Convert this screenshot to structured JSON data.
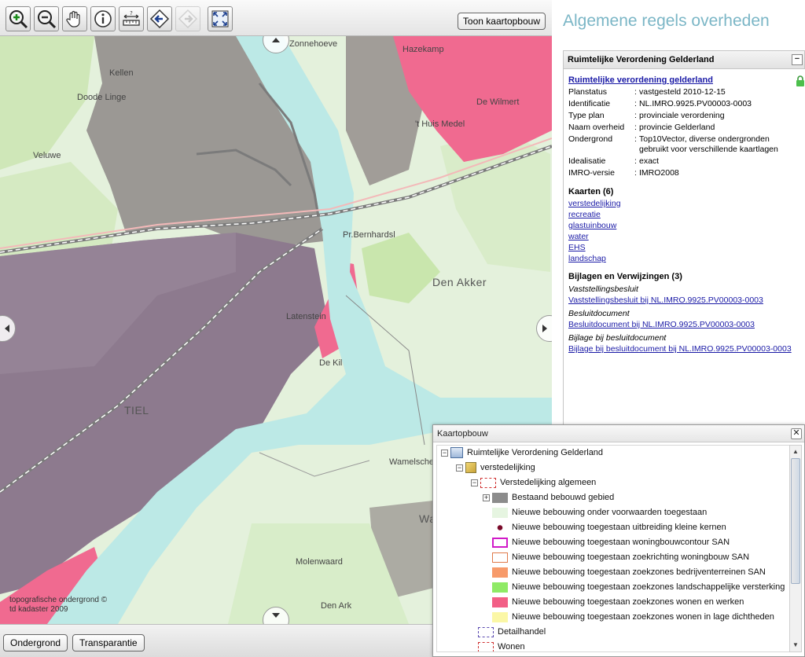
{
  "toolbar": {
    "tools": [
      {
        "name": "zoom-in-icon",
        "title": "Zoom in"
      },
      {
        "name": "zoom-out-icon",
        "title": "Zoom out"
      },
      {
        "name": "pan-hand-icon",
        "title": "Pan"
      },
      {
        "name": "info-icon",
        "title": "Info"
      },
      {
        "name": "measure-icon",
        "title": "Measure"
      },
      {
        "name": "previous-extent-icon",
        "title": "Previous"
      },
      {
        "name": "next-extent-icon",
        "title": "Next"
      },
      {
        "name": "full-extent-icon",
        "title": "Full extent"
      }
    ],
    "toon_label": "Toon kaartopbouw"
  },
  "map": {
    "places": {
      "zonnehoeve": "Zonnehoeve",
      "hazekamp": "Hazekamp",
      "kellen": "Kellen",
      "doode_linge": "Doode Linge",
      "de_wilmert": "De Wilmert",
      "huis_medel": "'t Huis Medel",
      "veluwe": "Veluwe",
      "pr_bernhardsl": "Pr.Bernhardsl",
      "den_akker": "Den Akker",
      "latenstein": "Latenstein",
      "de_kil": "De Kil",
      "tiel": "TIEL",
      "wamelsche": "Wamelsche",
      "wa": "Wa",
      "molenwaard": "Molenwaard",
      "den_ark": "Den Ark"
    },
    "copyright_line1": "topografische ondergrond ©",
    "copyright_line2": "td kadaster 2009"
  },
  "bottom": {
    "ondergrond": "Ondergrond",
    "transparantie": "Transparantie"
  },
  "info": {
    "title": "Algemene regels overheden",
    "panel_title": "Ruimtelijke Verordening Gelderland",
    "collapse": "−",
    "plan_link": "Ruimtelijke verordening gelderland",
    "meta": [
      {
        "k": "Planstatus",
        "v": "vastgesteld 2010-12-15"
      },
      {
        "k": "Identificatie",
        "v": "NL.IMRO.9925.PV00003-0003"
      },
      {
        "k": "Type plan",
        "v": "provinciale verordening"
      },
      {
        "k": "Naam overheid",
        "v": "provincie Gelderland"
      },
      {
        "k": "Ondergrond",
        "v": "Top10Vector, diverse ondergronden gebruikt voor verschillende kaartlagen"
      },
      {
        "k": "Idealisatie",
        "v": "exact"
      },
      {
        "k": "IMRO-versie",
        "v": "IMRO2008"
      }
    ],
    "kaarten_title": "Kaarten (6)",
    "kaarten": [
      "verstedelijking",
      "recreatie",
      "glastuinbouw",
      "water",
      "EHS",
      "landschap"
    ],
    "bijlagen_title": "Bijlagen en Verwijzingen (3)",
    "bijlagen": [
      {
        "label": "Vaststellingsbesluit",
        "link": "Vaststellingsbesluit bij NL.IMRO.9925.PV00003-0003"
      },
      {
        "label": "Besluitdocument",
        "link": "Besluitdocument bij NL.IMRO.9925.PV00003-0003"
      },
      {
        "label": "Bijlage bij besluitdocument",
        "link": "Bijlage bij besluitdocument bij NL.IMRO.9925.PV00003-0003"
      }
    ]
  },
  "legend": {
    "title": "Kaartopbouw",
    "close": "✕",
    "rows": [
      {
        "text": "Ruimtelijke Verordening Gelderland",
        "swatch": "plan-icon",
        "toggle": "−"
      },
      {
        "text": "verstedelijking",
        "swatch": "layer-icon",
        "toggle": "−"
      },
      {
        "text": "Verstedelijking algemeen",
        "swatch": "dashed-red",
        "toggle": "−"
      },
      {
        "text": "Bestaand bebouwd gebied",
        "swatch": "#8c8c8c",
        "toggle": "+"
      },
      {
        "text": "Nieuwe bebouwing onder voorwaarden toegestaan",
        "swatch": "#e6f5e1"
      },
      {
        "text": "Nieuwe bebouwing toegestaan uitbreiding kleine kernen",
        "swatch": "dot-maroon"
      },
      {
        "text": "Nieuwe bebouwing toegestaan woningbouwcontour SAN",
        "swatch": "outline-magenta"
      },
      {
        "text": "Nieuwe bebouwing toegestaan zoekrichting woningbouw SAN",
        "swatch": "outline-orange"
      },
      {
        "text": "Nieuwe bebouwing toegestaan zoekzones bedrijventerreinen SAN",
        "swatch": "#f79a6a"
      },
      {
        "text": "Nieuwe bebouwing toegestaan zoekzones landschappelijke versterking",
        "swatch": "#8fea66"
      },
      {
        "text": "Nieuwe bebouwing toegestaan zoekzones wonen en werken",
        "swatch": "#f25f86"
      },
      {
        "text": "Nieuwe bebouwing toegestaan zoekzones wonen in lage dichtheden",
        "swatch": "#fbf7a6"
      },
      {
        "text": "Detailhandel",
        "swatch": "dashed-purple"
      },
      {
        "text": "Wonen",
        "swatch": "dashed-red"
      }
    ]
  }
}
